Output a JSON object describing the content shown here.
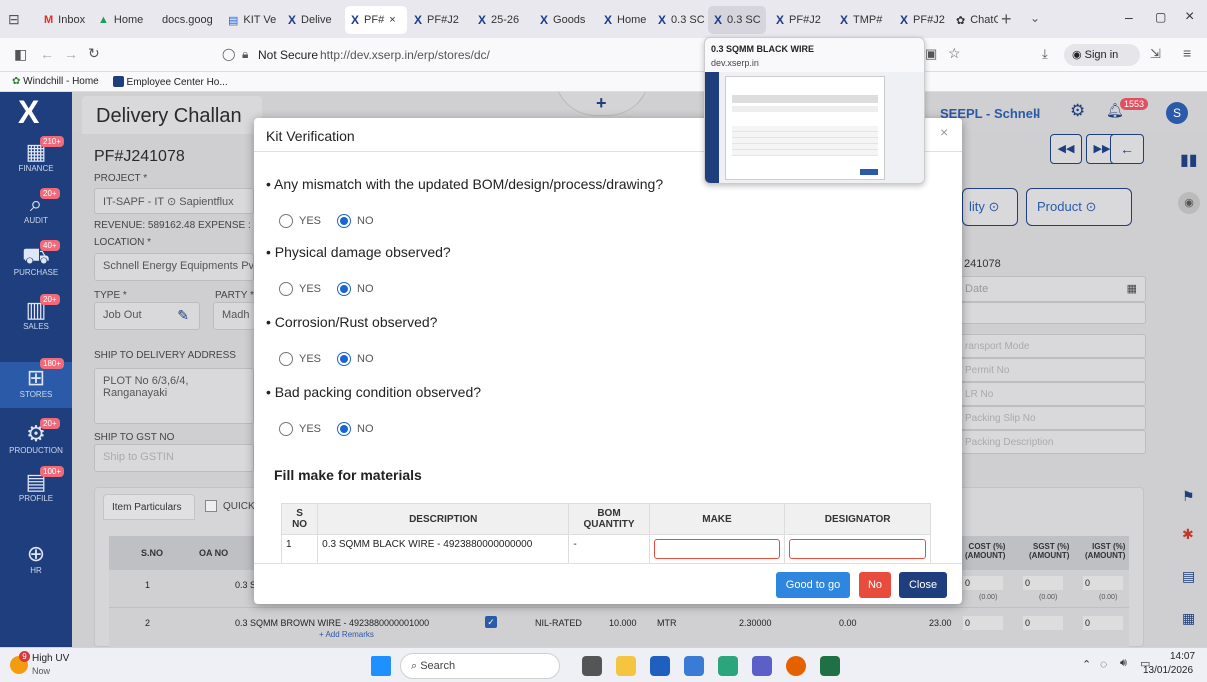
{
  "tabs": [
    {
      "label": "Inbox",
      "icon": "gmail-icon"
    },
    {
      "label": "Home",
      "icon": "drive-icon"
    },
    {
      "label": "docs.goog",
      "icon": "none"
    },
    {
      "label": "KIT Ve",
      "icon": "doc-icon"
    },
    {
      "label": "Delive",
      "icon": "x-icon"
    },
    {
      "label": "PF#",
      "icon": "x-icon"
    },
    {
      "label": "PF#J2",
      "icon": "x-icon"
    },
    {
      "label": "25-26",
      "icon": "x-icon"
    },
    {
      "label": "Goods",
      "icon": "x-icon"
    },
    {
      "label": "Home",
      "icon": "x-icon"
    },
    {
      "label": "0.3 SC",
      "icon": "x-icon"
    },
    {
      "label": "0.3 SC",
      "icon": "x-icon"
    },
    {
      "label": "PF#J2",
      "icon": "x-icon"
    },
    {
      "label": "TMP#",
      "icon": "x-icon"
    },
    {
      "label": "PF#J2",
      "icon": "x-icon"
    },
    {
      "label": "ChatG",
      "icon": "chatgpt-icon"
    }
  ],
  "url": {
    "security": "Not Secure",
    "address": "http://dev.xserp.in/erp/stores/dc/",
    "sign_in": "Sign in"
  },
  "bookmarks": [
    "Windchill - Home",
    "Employee Center Ho..."
  ],
  "preview": {
    "title": "0.3 SQMM BLACK WIRE",
    "host": "dev.xserp.in"
  },
  "header": {
    "title": "Delivery Challan",
    "company": "SEEPL - Schnell",
    "notif_count": "1553",
    "avatar": "S"
  },
  "sidebar": [
    {
      "label": "FINANCE",
      "badge": "210+"
    },
    {
      "label": "AUDIT",
      "badge": "20+"
    },
    {
      "label": "PURCHASE",
      "badge": "40+"
    },
    {
      "label": "SALES",
      "badge": "20+"
    },
    {
      "label": "STORES",
      "badge": "180+"
    },
    {
      "label": "PRODUCTION",
      "badge": "20+"
    },
    {
      "label": "PROFILE",
      "badge": "100+"
    },
    {
      "label": "HR",
      "badge": ""
    }
  ],
  "form": {
    "doc_no": "PF#J241078",
    "project_label": "PROJECT *",
    "project_value": "IT-SAPF - IT ⊙ Sapientflux",
    "revenue": "REVENUE: 589162.48  EXPENSE :",
    "location_label": "LOCATION *",
    "location_value": "Schnell Energy Equipments Pv",
    "type_label": "TYPE *",
    "type_value": "Job Out",
    "party_label": "PARTY *",
    "party_value": "Madh",
    "ship_addr_label": "SHIP TO DELIVERY ADDRESS",
    "ship_addr_value": "PLOT No 6/3,6/4, Ranganayaki",
    "gst_label": "SHIP TO GST NO",
    "gst_placeholder": "Ship to GSTIN",
    "right_quality": "lity",
    "right_product": "Product",
    "right_docno": "241078",
    "right_date": "Date",
    "right_fields": [
      "ransport Mode",
      "Permit No",
      "LR No",
      "Packing Slip No",
      "Packing Description"
    ]
  },
  "items": {
    "tab_label": "Item Particulars",
    "quick_label": "QUICK",
    "headers": [
      "S.NO",
      "OA NO"
    ],
    "right_headers": [
      "COST (%)\n(AMOUNT)",
      "SGST (%)\n(AMOUNT)",
      "IGST (%)\n(AMOUNT)"
    ],
    "rows": [
      {
        "sno": "1",
        "desc": "0.3 S",
        "tax": [
          "0",
          "0",
          "0"
        ],
        "amt": [
          "(0.00)",
          "(0.00)",
          "(0.00)"
        ]
      },
      {
        "sno": "2",
        "desc": "0.3 SQMM BROWN WIRE - 4923880000001000",
        "remarks": "+ Add Remarks",
        "rate_type": "NIL-RATED",
        "qty": "10.000",
        "unit": "MTR",
        "price": "2.30000",
        "disc": "0.00",
        "total": "23.00",
        "tax": [
          "0",
          "0",
          "0"
        ]
      }
    ]
  },
  "modal": {
    "title": "Kit Verification",
    "questions": [
      {
        "text": "• Any mismatch with the updated BOM/design/process/drawing?",
        "yes": "YES",
        "no": "NO",
        "selected": "NO"
      },
      {
        "text": "• Physical damage observed?",
        "yes": "YES",
        "no": "NO",
        "selected": "NO"
      },
      {
        "text": "• Corrosion/Rust observed?",
        "yes": "YES",
        "no": "NO",
        "selected": "NO"
      },
      {
        "text": "• Bad packing condition observed?",
        "yes": "YES",
        "no": "NO",
        "selected": "NO"
      }
    ],
    "section_title": "Fill make for materials",
    "table_headers": [
      "S\nNO",
      "DESCRIPTION",
      "BOM\nQUANTITY",
      "MAKE",
      "DESIGNATOR"
    ],
    "table_rows": [
      {
        "sno": "1",
        "desc": "0.3 SQMM BLACK WIRE - 4923880000000000",
        "bom_qty": "-"
      }
    ],
    "buttons": {
      "good": "Good to go",
      "no": "No",
      "close": "Close"
    },
    "close_x": "×"
  },
  "taskbar": {
    "weather_title": "High UV",
    "weather_sub": "Now",
    "weather_badge": "9",
    "search": "Search",
    "time": "14:07",
    "date": "13/01/2026"
  },
  "colors": {
    "sidebar": "#1f3e7d",
    "accent": "#1a66d2",
    "btn_good": "#2e86de",
    "btn_no": "#e74c3c",
    "btn_close": "#1f3e7d"
  }
}
